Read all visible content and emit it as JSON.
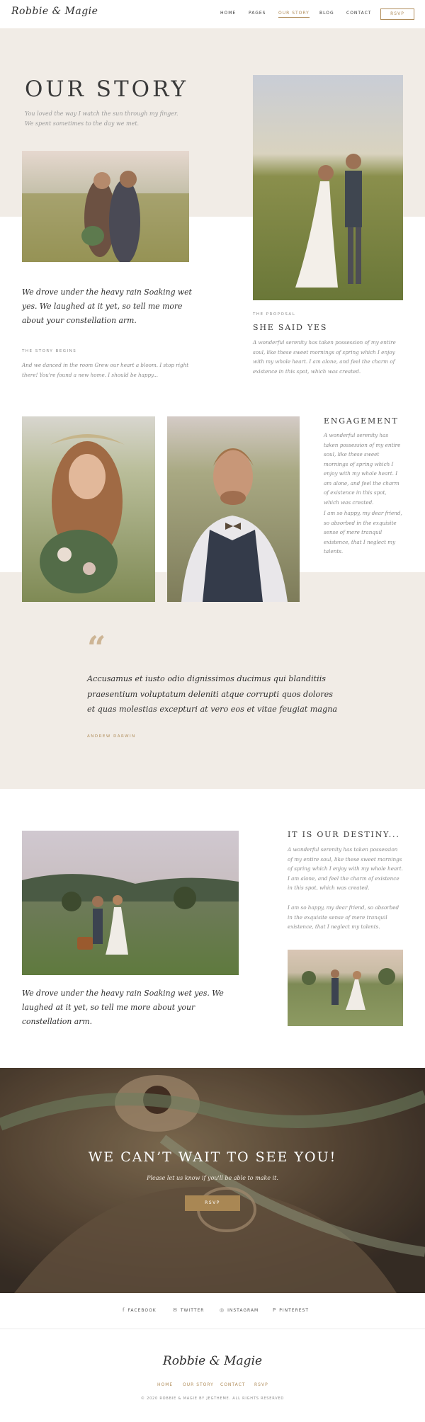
{
  "header": {
    "logo": "Robbie & Magie",
    "nav": [
      "HOME",
      "PAGES",
      "OUR STORY",
      "BLOG",
      "CONTACT"
    ],
    "rsvp": "RSVP"
  },
  "intro": {
    "title": "OUR STORY",
    "subtitle": "You loved the way I watch the sun through my finger. We spent sometimes to the day we met.",
    "lead": "We drove under the heavy rain Soaking wet yes. We laughed at it yet, so tell me more about your constellation arm.",
    "story_label": "THE STORY BEGINS",
    "story_text": "And we danced in the room Grew our heart a bloom. I stop right there! You're found a new home. I should be happy..."
  },
  "proposal": {
    "label": "THE PROPOSAL",
    "title": "SHE SAID YES",
    "text": "A wonderful serenity has taken possession of my entire soul, like these sweet mornings of spring which I enjoy with my whole heart. I am alone, and feel the charm of existence in this spot, which was created."
  },
  "engagement": {
    "title": "ENGAGEMENT",
    "text1": "A wonderful serenity has taken possession of my entire soul, like these sweet mornings of spring which I enjoy with my whole heart. I am alone, and feel the charm of existence in this spot, which was created.",
    "text2": "I am so happy, my dear friend, so absorbed in the exquisite sense of mere tranquil existence, that I neglect my talents."
  },
  "quote": {
    "mark": "“",
    "text": "Accusamus et iusto odio dignissimos ducimus qui blanditiis praesentium voluptatum deleniti atque corrupti quos dolores et quas molestias excepturi at vero eos et vitae feugiat magna",
    "author": "ANDREW DARWIN"
  },
  "destiny": {
    "title": "IT IS OUR DESTINY...",
    "text1": "A wonderful serenity has taken possession of my entire soul, like these sweet mornings of spring which I enjoy with my whole heart. I am alone, and feel the charm of existence in this spot, which was created.",
    "text2": "I am so happy, my dear friend, so absorbed in the exquisite sense of mere tranquil existence, that I neglect my talents.",
    "lead": "We drove under the heavy rain Soaking wet yes. We laughed at it yet, so tell me more about your constellation arm."
  },
  "cta": {
    "title": "WE CAN’T WAIT TO SEE YOU!",
    "subtitle": "Please let us know if you'll be able to make it.",
    "button": "RSVP"
  },
  "social": [
    {
      "icon": "f",
      "label": "FACEBOOK"
    },
    {
      "icon": "✉",
      "label": "TWITTER"
    },
    {
      "icon": "◎",
      "label": "INSTAGRAM"
    },
    {
      "icon": "P",
      "label": "PINTEREST"
    }
  ],
  "footer": {
    "logo": "Robbie & Magie",
    "nav": [
      "HOME",
      "OUR STORY",
      "CONTACT",
      "RSVP"
    ],
    "copyright": "© 2020 ROBBIE & MAGIE BY JEGTHEME. ALL RIGHTS RESERVED"
  }
}
